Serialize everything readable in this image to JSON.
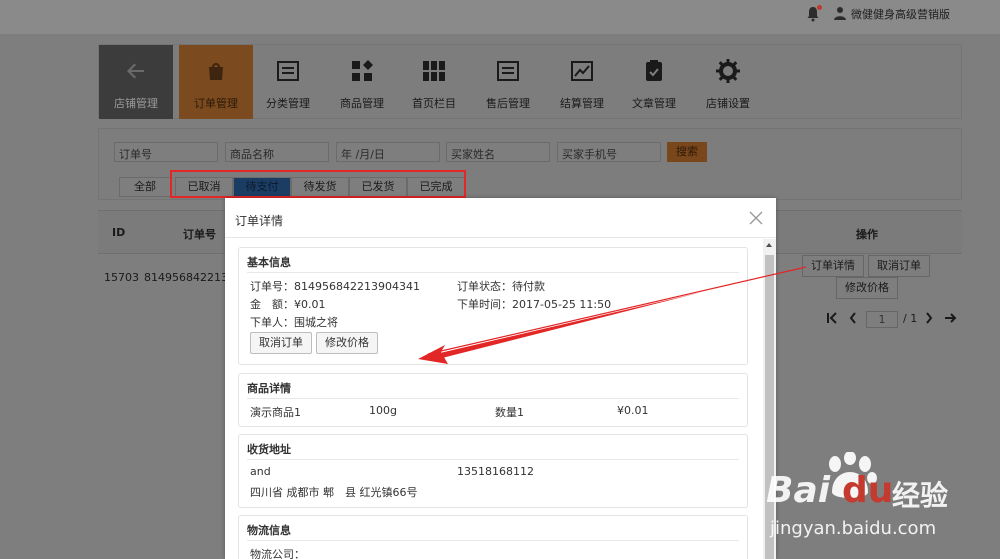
{
  "topbar": {
    "user_name": "微健健身高级营销版"
  },
  "nav": {
    "items": [
      {
        "label": "店铺管理",
        "icon": "arrow-left-icon"
      },
      {
        "label": "订单管理",
        "icon": "shopping-bag-icon"
      },
      {
        "label": "分类管理",
        "icon": "category-icon"
      },
      {
        "label": "商品管理",
        "icon": "grid-icon"
      },
      {
        "label": "首页栏目",
        "icon": "columns-icon"
      },
      {
        "label": "售后管理",
        "icon": "after-sales-icon"
      },
      {
        "label": "结算管理",
        "icon": "chart-icon"
      },
      {
        "label": "文章管理",
        "icon": "clipboard-icon"
      },
      {
        "label": "店铺设置",
        "icon": "gear-icon"
      }
    ],
    "active_index": 1
  },
  "filters": {
    "order_no_placeholder": "订单号",
    "product_name_placeholder": "商品名称",
    "date_placeholder": "年 /月/日",
    "buyer_name_placeholder": "买家姓名",
    "buyer_phone_placeholder": "买家手机号",
    "search_label": "搜索",
    "tabs": [
      "全部",
      "已取消",
      "待支付",
      "待发货",
      "已发货",
      "已完成"
    ],
    "active_tab": 2
  },
  "table": {
    "headers": [
      "ID",
      "订单号",
      "操作"
    ],
    "row": {
      "id": "15703",
      "order_no_partial": "81495684221390",
      "actions": [
        "订单详情",
        "取消订单",
        "修改价格"
      ]
    },
    "pagination": {
      "current_page": "1",
      "total": "/ 1"
    }
  },
  "modal": {
    "title": "订单详情",
    "basic": {
      "title": "基本信息",
      "order_no": "订单号：814956842213904341",
      "status": "订单状态：待付款",
      "amount": "金　额：¥0.01",
      "order_time": "下单时间：2017-05-25 11:50",
      "buyer": "下单人：围城之将",
      "cancel_label": "取消订单",
      "modify_label": "修改价格"
    },
    "goods": {
      "title": "商品详情",
      "name": "演示商品1",
      "spec": "100g",
      "quantity": "数量1",
      "price": "¥0.01"
    },
    "address": {
      "title": "收货地址",
      "recipient": "and",
      "phone": "13518168112",
      "region": "四川省 成都市 郫　县 红光镇66号"
    },
    "logistics": {
      "title": "物流信息",
      "company": "物流公司："
    }
  },
  "watermark": {
    "brand": "Bai",
    "brand_du": "du",
    "brand_cn": "经验",
    "url": "jingyan.baidu.com"
  },
  "colors": {
    "accent_orange": "#f08a24",
    "active_tab_blue": "#2f7ad6",
    "annotation_red": "#e32626"
  }
}
